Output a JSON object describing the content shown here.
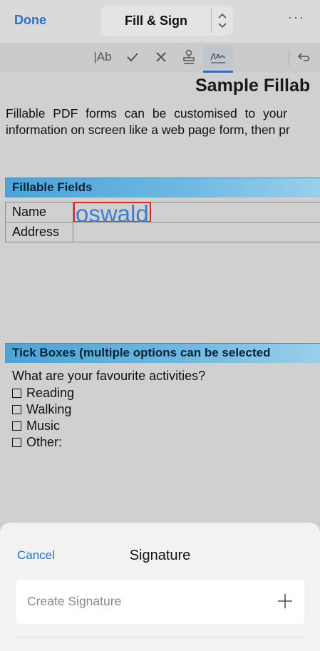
{
  "topbar": {
    "done_label": "Done",
    "mode_label": "Fill & Sign",
    "more_label": "···"
  },
  "toolbar": {
    "text_tool_label": "|Ab",
    "tools": [
      "text-tool",
      "checkmark-tool",
      "cross-tool",
      "stamp-tool",
      "signature-tool",
      "undo"
    ],
    "active_tool": "signature-tool",
    "accent_color": "#2e6fc9"
  },
  "document": {
    "title": "Sample Fillab",
    "paragraph_line1": "Fillable PDF forms can be customised to your",
    "paragraph_line2": "information on screen like a web page form, then pr",
    "section1_title": "Fillable Fields",
    "fields": [
      {
        "label": "Name",
        "value": "oswald"
      },
      {
        "label": "Address",
        "value": ""
      }
    ],
    "section2_title": "Tick Boxes (multiple options can be selected",
    "question": "What are your favourite activities?",
    "checkboxes": [
      {
        "label": "Reading"
      },
      {
        "label": "Walking"
      },
      {
        "label": "Music"
      },
      {
        "label": "Other:"
      }
    ],
    "filled_value_color": "#3a80d2",
    "selection_border_color": "#d12c2c"
  },
  "sheet": {
    "cancel_label": "Cancel",
    "title": "Signature",
    "create_label": "Create Signature"
  }
}
